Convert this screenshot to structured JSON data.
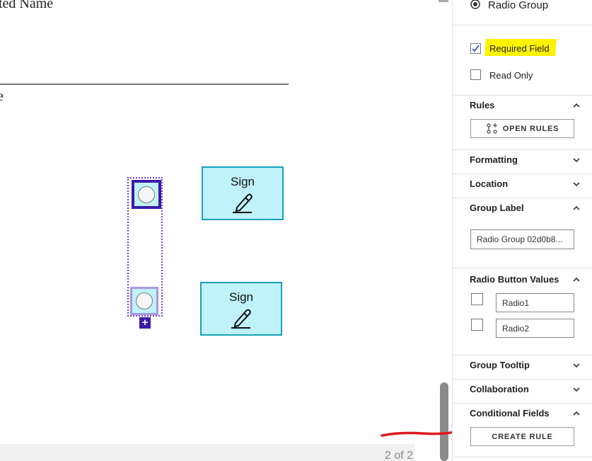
{
  "document": {
    "partial_heading": "ted Name",
    "partial_label": "e",
    "page_indicator": "2 of 2"
  },
  "sign_fields": [
    {
      "label": "Sign"
    },
    {
      "label": "Sign"
    }
  ],
  "radio_group": {
    "add_symbol": "+"
  },
  "panel": {
    "field_type_option": "Radio Group",
    "required_field": {
      "label": "Required Field",
      "checked": true,
      "highlight": "#fff200"
    },
    "read_only": {
      "label": "Read Only",
      "checked": false
    },
    "sections": {
      "rules": {
        "title": "Rules",
        "button": "OPEN RULES"
      },
      "formatting": {
        "title": "Formatting"
      },
      "location": {
        "title": "Location"
      },
      "group_label": {
        "title": "Group Label",
        "value": "Radio Group 02d0b8..."
      },
      "radio_button_values": {
        "title": "Radio Button Values",
        "values": [
          "Radio1",
          "Radio2"
        ]
      },
      "group_tooltip": {
        "title": "Group Tooltip"
      },
      "collaboration": {
        "title": "Collaboration"
      },
      "conditional_fields": {
        "title": "Conditional Fields",
        "button": "CREATE RULE"
      }
    }
  },
  "colors": {
    "field_fill": "#bff2fb",
    "field_border": "#17a2b8",
    "selection": "#3a1aa8",
    "annotation": "#e0191c"
  }
}
